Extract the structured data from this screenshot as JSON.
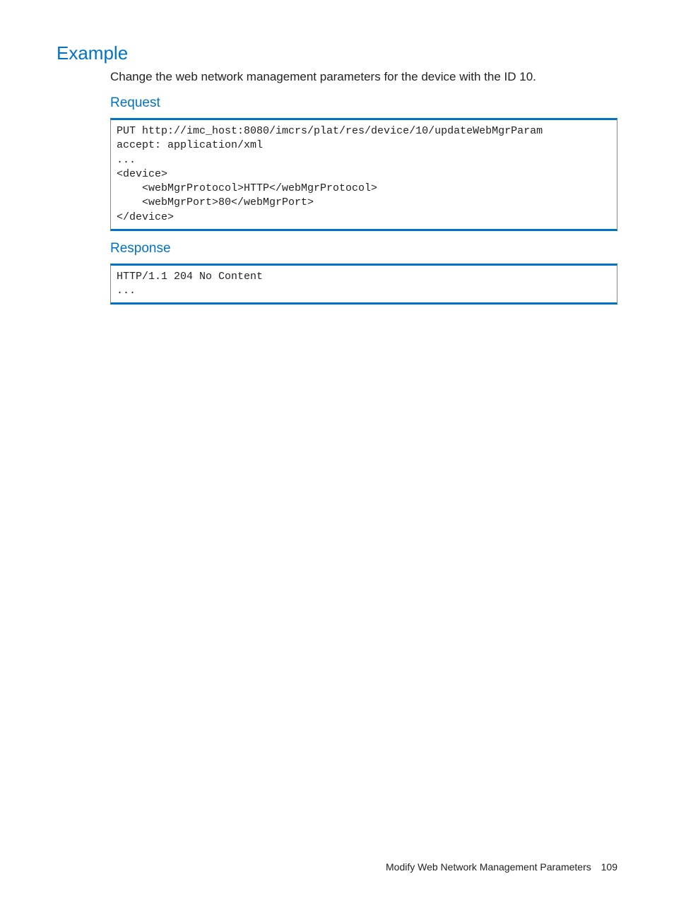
{
  "headings": {
    "example": "Example",
    "request": "Request",
    "response": "Response"
  },
  "intro": "Change the web network management parameters for the device with the ID 10.",
  "code": {
    "request": "PUT http://imc_host:8080/imcrs/plat/res/device/10/updateWebMgrParam\naccept: application/xml\n...\n<device>\n    <webMgrProtocol>HTTP</webMgrProtocol>\n    <webMgrPort>80</webMgrPort>\n</device>",
    "response": "HTTP/1.1 204 No Content\n..."
  },
  "footer": {
    "title": "Modify Web Network Management Parameters",
    "page": "109"
  }
}
